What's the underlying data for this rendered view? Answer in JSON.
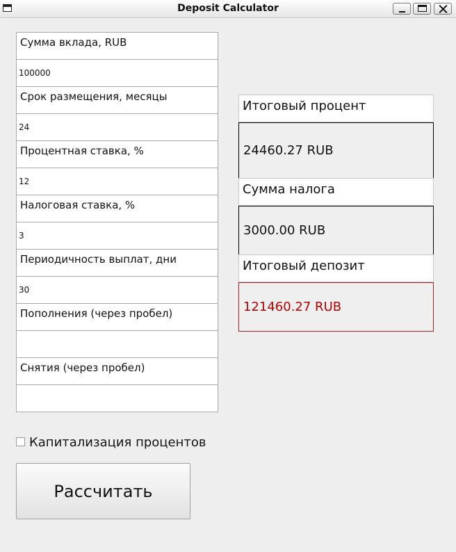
{
  "window": {
    "title": "Deposit Calculator"
  },
  "form": {
    "fields": [
      {
        "label": "Сумма вклада, RUB",
        "value": "100000"
      },
      {
        "label": "Срок размещения, месяцы",
        "value": "24"
      },
      {
        "label": "Процентная ставка, %",
        "value": "12"
      },
      {
        "label": "Налоговая ставка, %",
        "value": "3"
      },
      {
        "label": "Периодичность выплат, дни",
        "value": "30"
      },
      {
        "label": "Пополнения (через пробел)",
        "value": ""
      },
      {
        "label": "Снятия (через пробел)",
        "value": ""
      }
    ],
    "capitalization": {
      "label": "Капитализация процентов",
      "checked": false
    },
    "calculate_label": "Рассчитать"
  },
  "results": {
    "total_interest": {
      "label": "Итоговый процент",
      "value": "24460.27 RUB"
    },
    "tax_amount": {
      "label": "Сумма налога",
      "value": "3000.00 RUB"
    },
    "total_deposit": {
      "label": "Итоговый депозит",
      "value": "121460.27 RUB",
      "color": "#b80000"
    }
  }
}
